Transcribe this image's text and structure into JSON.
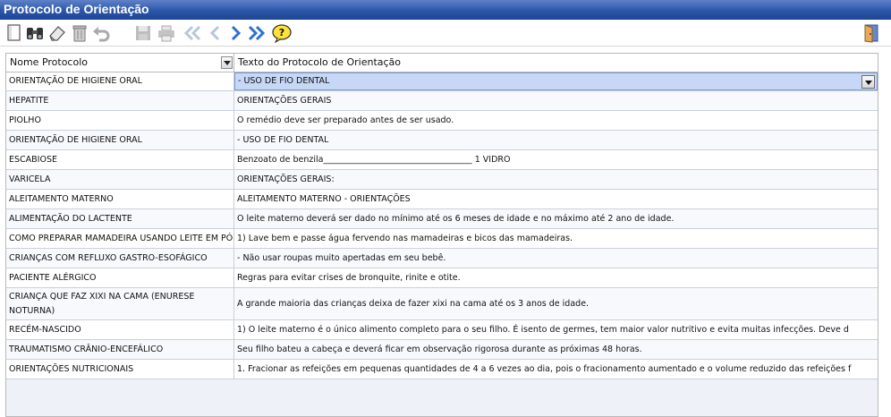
{
  "window": {
    "title": "Protocolo de Orientação"
  },
  "toolbar": {
    "buttons": [
      {
        "icon": "new-document-icon"
      },
      {
        "icon": "binoculars-search-icon"
      },
      {
        "icon": "eraser-icon"
      },
      {
        "icon": "trash-icon"
      },
      {
        "icon": "undo-icon"
      },
      {
        "icon": "save-disk-icon"
      },
      {
        "icon": "printer-icon"
      },
      {
        "icon": "first-record-icon"
      },
      {
        "icon": "previous-record-icon"
      },
      {
        "icon": "next-record-icon"
      },
      {
        "icon": "last-record-icon"
      },
      {
        "icon": "help-icon"
      },
      {
        "icon": "exit-door-icon"
      }
    ]
  },
  "grid": {
    "columns": [
      "Nome Protocolo",
      "Texto do Protocolo de Orientação"
    ],
    "rows": [
      {
        "name": "ORIENTAÇÃO DE HIGIENE ORAL",
        "text": "- USO DE FIO DENTAL"
      },
      {
        "name": "HEPATITE",
        "text": "ORIENTAÇÕES GERAIS"
      },
      {
        "name": "PIOLHO",
        "text": "O remédio deve ser preparado antes de ser usado."
      },
      {
        "name": "ORIENTAÇÃO DE HIGIENE ORAL",
        "text": "- USO DE FIO DENTAL"
      },
      {
        "name": "ESCABIOSE",
        "text": "Benzoato de benzila___________________________________ 1 VIDRO"
      },
      {
        "name": "VARICELA",
        "text": "ORIENTAÇÕES GERAIS:"
      },
      {
        "name": "ALEITAMENTO MATERNO",
        "text": "ALEITAMENTO MATERNO  -  ORIENTAÇÕES"
      },
      {
        "name": "ALIMENTAÇÃO DO LACTENTE",
        "text": "O leite materno deverá ser dado no mínimo até os 6 meses de idade e no máximo até 2 ano de idade."
      },
      {
        "name": "COMO PREPARAR MAMADEIRA USANDO LEITE EM PÓ",
        "text": "1) Lave bem e passe água fervendo nas mamadeiras e bicos das mamadeiras."
      },
      {
        "name": "CRIANÇAS COM REFLUXO GASTRO-ESOFÁGICO",
        "text": "-  Não usar roupas muito apertadas em seu bebê."
      },
      {
        "name": "PACIENTE ALÉRGICO",
        "text": "Regras para evitar crises de bronquite, rinite e otite."
      },
      {
        "name": "CRIANÇA QUE FAZ XIXI NA CAMA (ENURESE NOTURNA)",
        "text": "A grande maioria das crianças deixa de fazer xixi na cama até os 3 anos de idade."
      },
      {
        "name": "RECÉM-NASCIDO",
        "text": "1) O leite materno é o único alimento completo para o seu filho.  É isento de germes, tem maior valor nutritivo e evita muitas infecções. Deve d"
      },
      {
        "name": "TRAUMATISMO CRÂNIO-ENCEFÁLICO",
        "text": "Seu filho bateu a cabeça e deverá ficar em observação rigorosa durante as próximas 48 horas."
      },
      {
        "name": "ORIENTAÇÕES NUTRICIONAIS",
        "text": "1. Fracionar as refeições em pequenas quantidades de 4 a 6 vezes ao dia, pois o fracionamento aumentado e o volume reduzido das refeições f"
      }
    ]
  }
}
